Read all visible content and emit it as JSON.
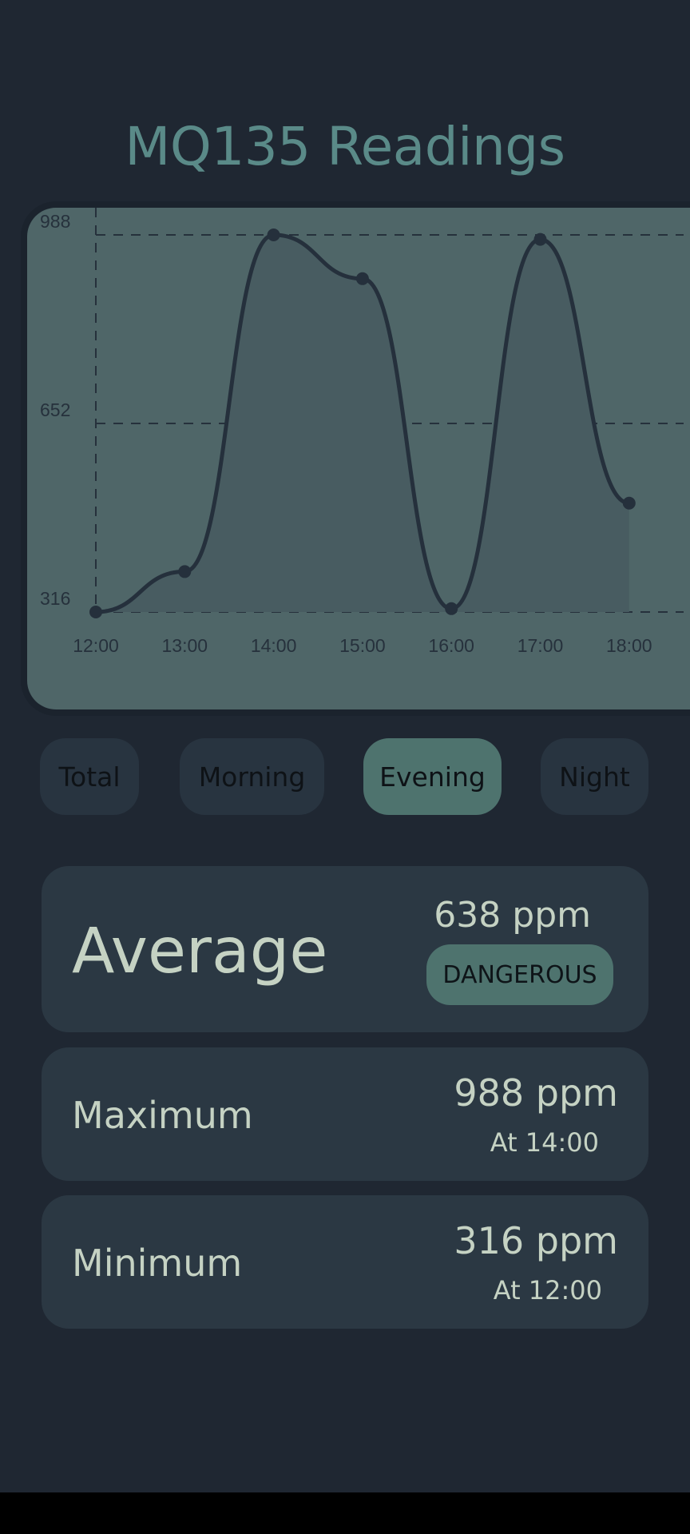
{
  "title": "MQ135 Readings",
  "chart_data": {
    "type": "line",
    "x": [
      "12:00",
      "13:00",
      "14:00",
      "15:00",
      "16:00",
      "17:00",
      "18:00"
    ],
    "series": [
      {
        "values": [
          316,
          388,
          988,
          910,
          322,
          980,
          510
        ]
      }
    ],
    "yticks": [
      988,
      652,
      316
    ],
    "ylim": [
      316,
      988
    ],
    "grid": true,
    "smooth": true,
    "line_color": "#25303c",
    "fill": true
  },
  "filters": {
    "total": "Total",
    "morning": "Morning",
    "evening": "Evening",
    "night": "Night",
    "selected": "Evening"
  },
  "average": {
    "label": "Average",
    "value": "638 ppm",
    "status": "DANGEROUS"
  },
  "maximum": {
    "label": "Maximum",
    "value": "988 ppm",
    "time": "At 14:00"
  },
  "minimum": {
    "label": "Minimum",
    "value": "316 ppm",
    "time": "At 12:00"
  },
  "colors": {
    "background": "#1f2732",
    "accent": "#4e736e",
    "title": "#5a8a88",
    "card": "#2b3843",
    "chart_bg": "#4f6668"
  }
}
